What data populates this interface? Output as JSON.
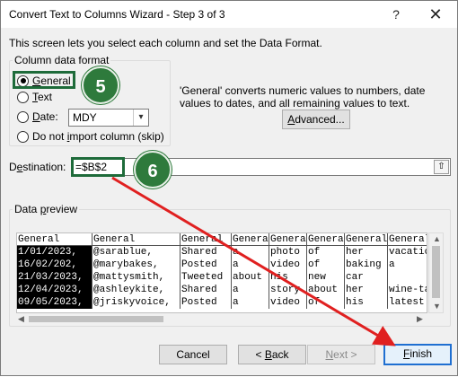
{
  "window": {
    "title": "Convert Text to Columns Wizard - Step 3 of 3",
    "help": "?",
    "close": "✕"
  },
  "intro": "This screen lets you select each column and set the Data Format.",
  "format_group": {
    "legend": "Column data format",
    "options": [
      {
        "label_u": "G",
        "label_rest": "eneral",
        "checked": true
      },
      {
        "label_u": "T",
        "label_rest": "ext",
        "checked": false
      },
      {
        "label_u": "D",
        "label_rest": "ate:",
        "checked": false
      },
      {
        "label_pre": "Do not ",
        "label_u": "i",
        "label_rest": "mport column (skip)",
        "checked": false
      }
    ],
    "date_format": "MDY"
  },
  "info": "'General' converts numeric values to numbers, date values to dates, and all remaining values to text.",
  "advanced_button": {
    "label_u": "A",
    "label_rest": "dvanced..."
  },
  "destination": {
    "label_pre": "D",
    "label_u": "e",
    "label_rest": "stination:",
    "value": "=$B$2",
    "collapse_icon": "⇧"
  },
  "badges": {
    "step5": "5",
    "step6": "6"
  },
  "preview": {
    "legend_pre": "Data ",
    "legend_u": "p",
    "legend_rest": "review",
    "headers": [
      "General",
      "General",
      "General",
      "General",
      "General",
      "General",
      "General",
      "General"
    ],
    "rows": [
      [
        "1/01/2023,",
        "@sarablue,",
        "Shared",
        "a",
        "photo",
        "of",
        "her",
        "vacatio"
      ],
      [
        "16/02/202,",
        "@marybakes,",
        "Posted",
        "a",
        "video",
        "of",
        "baking",
        "a"
      ],
      [
        "21/03/2023,",
        "@mattysmith,",
        "Tweeted",
        "about",
        "his",
        "new",
        "car",
        ""
      ],
      [
        "12/04/2023,",
        "@ashleykite,",
        "Shared",
        "a",
        "story",
        "about",
        "her",
        "wine-ta"
      ],
      [
        "09/05/2023,",
        "@jriskyvoice,",
        "Posted",
        "a",
        "video",
        "of",
        "his",
        "latest"
      ]
    ]
  },
  "buttons": {
    "cancel": "Cancel",
    "back_pre": "< ",
    "back_u": "B",
    "back_rest": "ack",
    "next_pre": "",
    "next_u": "N",
    "next_rest": "ext >",
    "finish_u": "F",
    "finish_rest": "inish"
  },
  "colors": {
    "highlight": "#1e6b3a",
    "badge": "#2e7a3c",
    "arrow": "#e02020",
    "default_button": "#1f6fd1"
  }
}
